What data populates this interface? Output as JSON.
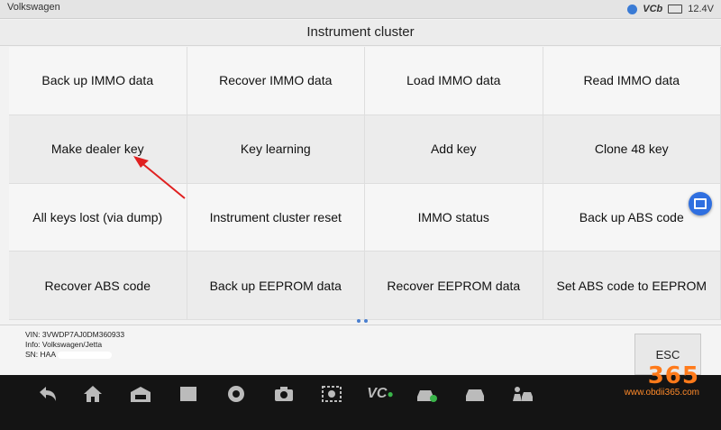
{
  "status_bar": {
    "title": "Volkswagen",
    "vcb_label": "VCb",
    "battery": "12.4V"
  },
  "header": {
    "title": "Instrument cluster"
  },
  "functions": [
    "Back up IMMO data",
    "Recover IMMO data",
    "Load IMMO data",
    "Read IMMO data",
    "Make dealer key",
    "Key learning",
    "Add key",
    "Clone 48 key",
    "All keys lost (via dump)",
    "Instrument cluster reset",
    "IMMO status",
    "Back up ABS code",
    "Recover ABS code",
    "Back up EEPROM data",
    "Recover EEPROM data",
    "Set ABS code to EEPROM"
  ],
  "vehicle_info": {
    "vin": "VIN: 3VWDP7AJ0DM360933",
    "info": "Info: Volkswagen/Jetta",
    "sn": "SN: HAA"
  },
  "esc_label": "ESC",
  "annotation": {
    "color": "#e02020"
  },
  "taskbar": {
    "icons": [
      "back-icon",
      "home-icon",
      "car-garage-icon",
      "recent-apps-icon",
      "chrome-icon",
      "camera-icon",
      "screen-capture-icon",
      "vci-icon",
      "car-diagnose-icon",
      "car-icon",
      "person-car-icon"
    ],
    "vci_label": "VC"
  },
  "watermark": {
    "number": "365",
    "url": "www.obdii365.com"
  }
}
